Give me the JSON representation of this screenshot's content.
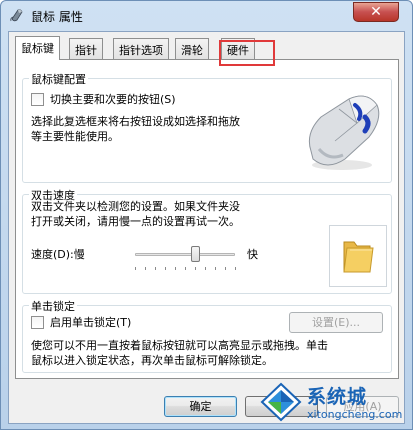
{
  "window": {
    "title": "鼠标 属性",
    "close_glyph": "✕"
  },
  "tabs": [
    {
      "label": "鼠标键",
      "active": true
    },
    {
      "label": "指针",
      "active": false
    },
    {
      "label": "指针选项",
      "active": false
    },
    {
      "label": "滑轮",
      "active": false
    },
    {
      "label": "硬件",
      "active": false,
      "highlighted": true
    }
  ],
  "button_config": {
    "group_label": "鼠标键配置",
    "checkbox_label": "切换主要和次要的按钮(S)",
    "checked": false,
    "description_line1": "选择此复选框来将右按钮设成如选择和拖放",
    "description_line2": "等主要性能使用。"
  },
  "double_click": {
    "group_label": "双击速度",
    "description_line1": "双击文件夹以检测您的设置。如果文件夹没",
    "description_line2": "打开或关闭，请用慢一点的设置再试一次。",
    "speed_label": "速度(D):慢",
    "fast_label": "快",
    "speed_value": 0.6
  },
  "click_lock": {
    "group_label": "单击锁定",
    "checkbox_label": "启用单击锁定(T)",
    "checked": false,
    "settings_button": "设置(E)...",
    "description_line1": "使您可以不用一直按着鼠标按钮就可以高亮显示或拖拽。单击",
    "description_line2": "鼠标以进入锁定状态，再次单击鼠标可解除锁定。"
  },
  "footer": {
    "ok_label": "确定",
    "cancel_label": "取消",
    "apply_label": "应用(A)"
  },
  "watermark": {
    "brand": "系统城",
    "url": "xitongcheng.com"
  },
  "colors": {
    "highlight": "#e0393a",
    "accent_blue": "#1a64b6"
  }
}
